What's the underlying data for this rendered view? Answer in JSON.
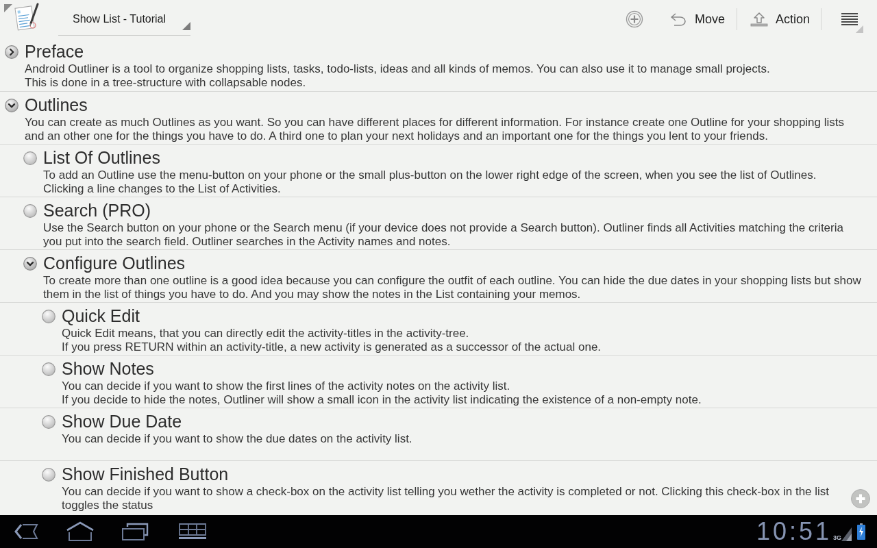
{
  "action_bar": {
    "list_title": "Show List - Tutorial",
    "move_button": {
      "label": "Move"
    },
    "action_button": {
      "label": "Action"
    }
  },
  "outline": [
    {
      "kind": "branch",
      "expanded": false,
      "title": "Preface",
      "note": "Android Outliner is a tool to organize shopping lists, tasks, todo-lists, ideas and all kinds of memos. You can also use it to manage small projects.\nThis is done in a tree-structure with collapsable nodes."
    },
    {
      "kind": "branch",
      "expanded": true,
      "title": "Outlines",
      "note": "You can create as much Outlines as you want. So you can have different places for different information. For instance create one Outline for your shopping lists\nand an other one for the things you have to do. A third one to plan your next holidays and an important one for the things you lent to your friends.",
      "children": [
        {
          "kind": "leaf",
          "title": "List Of Outlines",
          "note": "To add an Outline use the menu-button on your phone or the small plus-button on the lower right edge of the screen, when you see the list of Outlines.\nClicking a line changes to the List of Activities."
        },
        {
          "kind": "leaf",
          "title": "Search (PRO)",
          "note": "Use the Search button on your phone or the Search menu (if your device does not provide a Search button). Outliner finds all Activities matching the criteria\nyou put into the search field. Outliner searches in the Activity names and notes."
        },
        {
          "kind": "branch",
          "expanded": true,
          "title": "Configure Outlines",
          "note": "To create more than one outline is a good idea because you can configure the outfit of each outline. You can hide the due dates in your shopping lists but show\nthem in the list of things you have to do. And you may show the notes in the List containing your memos.",
          "children": [
            {
              "kind": "leaf",
              "title": "Quick Edit",
              "note": "Quick Edit means, that you can directly edit the activity-titles in the activity-tree.\nIf you press RETURN within an activity-title, a new activity is generated as a successor of the actual one."
            },
            {
              "kind": "leaf",
              "title": "Show Notes",
              "note": "You can decide if you want to show the first lines of the activity notes on the activity list.\nIf you decide to hide the notes, Outliner will show a small icon in the activity list indicating the existence of a non-empty note."
            },
            {
              "kind": "leaf",
              "title": "Show Due Date",
              "note": "You can decide if you want to show the due dates on the activity list."
            },
            {
              "kind": "leaf",
              "title": "Show Finished Button",
              "note": "You can decide if you want to show a check-box on the activity list telling you wether the activity is completed or not. Clicking this check-box in the list\ntoggles the status"
            }
          ]
        }
      ]
    }
  ],
  "nav_bar": {
    "clock": "10:51",
    "network": "3G"
  }
}
